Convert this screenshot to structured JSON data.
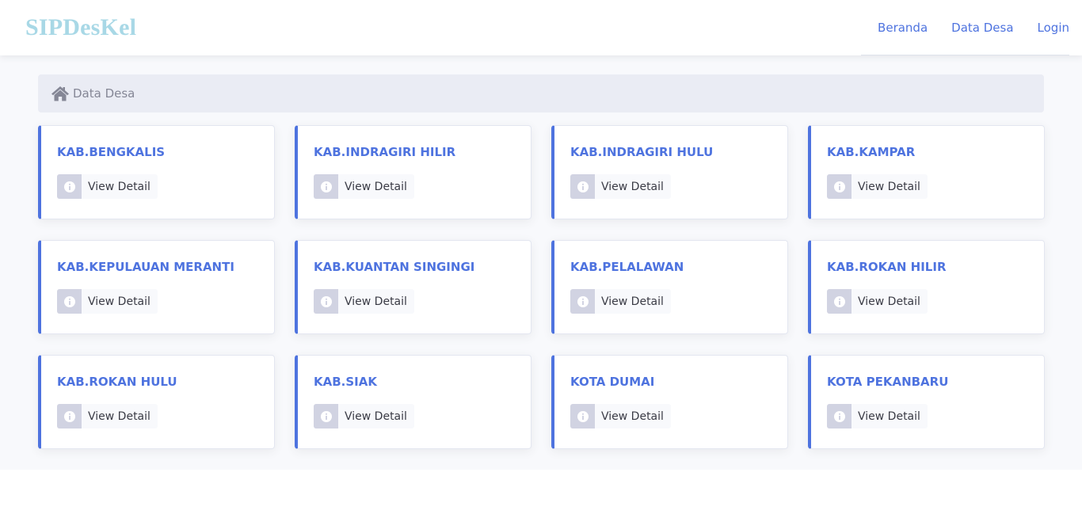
{
  "nav": {
    "brand": "SIPDesKel",
    "links": [
      "Beranda",
      "Data Desa",
      "Login"
    ]
  },
  "breadcrumb": {
    "icon": "home-icon",
    "label": "Data Desa"
  },
  "cards": [
    {
      "title": "KAB.BENGKALIS",
      "button": "View Detail"
    },
    {
      "title": "KAB.INDRAGIRI HILIR",
      "button": "View Detail"
    },
    {
      "title": "KAB.INDRAGIRI HULU",
      "button": "View Detail"
    },
    {
      "title": "KAB.KAMPAR",
      "button": "View Detail"
    },
    {
      "title": "KAB.KEPULAUAN MERANTI",
      "button": "View Detail"
    },
    {
      "title": "KAB.KUANTAN SINGINGI",
      "button": "View Detail"
    },
    {
      "title": "KAB.PELALAWAN",
      "button": "View Detail"
    },
    {
      "title": "KAB.ROKAN HILIR",
      "button": "View Detail"
    },
    {
      "title": "KAB.ROKAN HULU",
      "button": "View Detail"
    },
    {
      "title": "KAB.SIAK",
      "button": "View Detail"
    },
    {
      "title": "KOTA DUMAI",
      "button": "View Detail"
    },
    {
      "title": "KOTA PEKANBARU",
      "button": "View Detail"
    }
  ],
  "colors": {
    "accent": "#4e73df",
    "brand": "#a8d8e6",
    "page_bg": "#f8f9fc",
    "breadcrumb_bg": "#eaecf4"
  }
}
